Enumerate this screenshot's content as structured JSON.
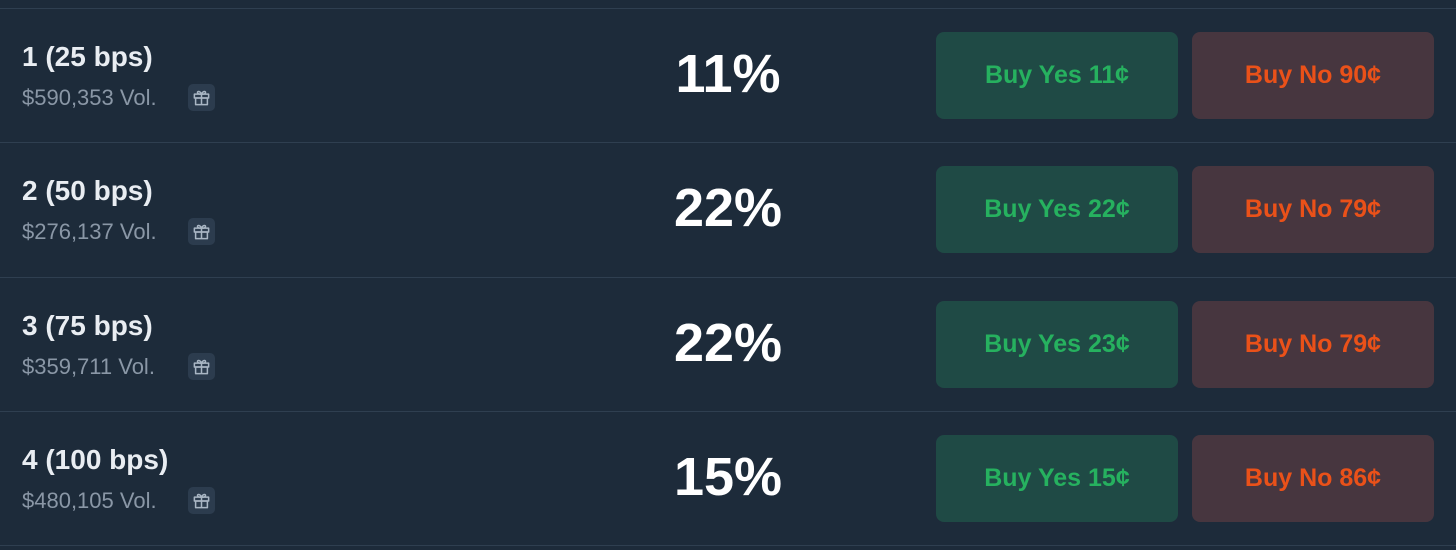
{
  "colors": {
    "background": "#1d2b3a",
    "divider": "#2f3f50",
    "yes_text": "#26b15f",
    "yes_bg": "#1f4a45",
    "no_text": "#ea5119",
    "no_bg": "#47363f"
  },
  "rows": [
    {
      "title": "1 (25 bps)",
      "volume": "$590,353 Vol.",
      "icon": "gift-icon",
      "probability": "11%",
      "yes_label": "Buy Yes 11¢",
      "no_label": "Buy No 90¢"
    },
    {
      "title": "2 (50 bps)",
      "volume": "$276,137 Vol.",
      "icon": "gift-icon",
      "probability": "22%",
      "yes_label": "Buy Yes 22¢",
      "no_label": "Buy No 79¢"
    },
    {
      "title": "3 (75 bps)",
      "volume": "$359,711 Vol.",
      "icon": "gift-icon",
      "probability": "22%",
      "yes_label": "Buy Yes 23¢",
      "no_label": "Buy No 79¢"
    },
    {
      "title": "4 (100 bps)",
      "volume": "$480,105 Vol.",
      "icon": "gift-icon",
      "probability": "15%",
      "yes_label": "Buy Yes 15¢",
      "no_label": "Buy No 86¢"
    }
  ]
}
